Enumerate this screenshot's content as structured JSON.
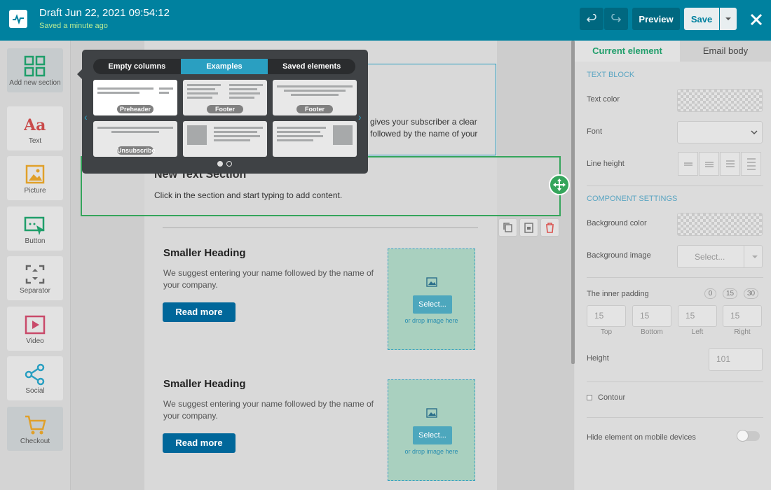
{
  "header": {
    "title": "Draft Jun 22, 2021 09:54:12",
    "status": "Saved a minute ago",
    "preview_label": "Preview",
    "save_label": "Save"
  },
  "sidebar": {
    "items": [
      {
        "label": "Add new section",
        "icon": "grid-icon"
      },
      {
        "label": "Text",
        "icon": "text-icon"
      },
      {
        "label": "Picture",
        "icon": "picture-icon"
      },
      {
        "label": "Button",
        "icon": "button-icon"
      },
      {
        "label": "Separator",
        "icon": "separator-icon"
      },
      {
        "label": "Video",
        "icon": "video-icon"
      },
      {
        "label": "Social",
        "icon": "share-icon"
      },
      {
        "label": "Checkout",
        "icon": "cart-icon"
      }
    ]
  },
  "popup": {
    "tabs": [
      "Empty columns",
      "Examples",
      "Saved elements"
    ],
    "thumbs": [
      "Preheader",
      "Footer",
      "Footer",
      "Unsubscribe",
      "",
      ""
    ]
  },
  "canvas": {
    "peek_line1": "gives your subscriber a clear",
    "peek_line2": "followed by the name of your",
    "new_section_title": "New Text Section",
    "new_section_body": "Click in the section and start typing to add content.",
    "cards": [
      {
        "heading": "Smaller Heading",
        "text": "We suggest entering your name followed by the name of your company.",
        "button": "Read more",
        "select": "Select...",
        "drop": "or drop image here"
      },
      {
        "heading": "Smaller Heading",
        "text": "We suggest entering your name followed by the name of your company.",
        "button": "Read more",
        "select": "Select...",
        "drop": "or drop image here"
      }
    ]
  },
  "panel": {
    "tab_current": "Current element",
    "tab_body": "Email body",
    "text_block": "TEXT BLOCK",
    "text_color": "Text color",
    "font": "Font",
    "line_height": "Line height",
    "component_settings": "COMPONENT SETTINGS",
    "bg_color": "Background color",
    "bg_image": "Background image",
    "bg_image_value": "Select...",
    "inner_padding": "The inner padding",
    "padding_presets": [
      "0",
      "15",
      "30"
    ],
    "padding_values": [
      "15",
      "15",
      "15",
      "15"
    ],
    "padding_labels": [
      "Top",
      "Bottom",
      "Left",
      "Right"
    ],
    "height": "Height",
    "height_value": "101",
    "contour": "Contour",
    "hide_mobile": "Hide element on mobile devices"
  },
  "colors": {
    "header": "#00819f",
    "accent_green": "#35a55b",
    "accent_blue": "#2a9fc1"
  }
}
